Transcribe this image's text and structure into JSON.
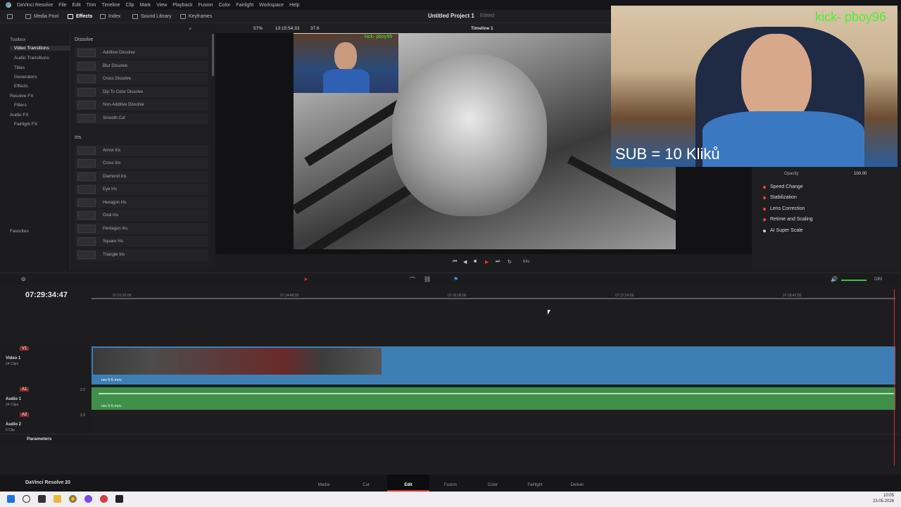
{
  "menu": {
    "app": "DaVinci Resolve",
    "items": [
      "File",
      "Edit",
      "Trim",
      "Timeline",
      "Clip",
      "Mark",
      "View",
      "Playback",
      "Fusion",
      "Color",
      "Fairlight",
      "Workspace",
      "Help"
    ]
  },
  "toolbar": {
    "media_pool": "Media Pool",
    "effects": "Effects",
    "index": "Index",
    "sound_library": "Sound Library",
    "keyframes": "Keyframes",
    "project_title": "Untitled Project 1",
    "project_status": "Edited",
    "zoom": "57%",
    "viewer_timecode": "13:15:54:33",
    "viewer_value": "37.6",
    "timeline_name": "Timeline 1"
  },
  "left_panel": {
    "items": [
      "Toolbox",
      "Video Transitions",
      "Audio Transitions",
      "Titles",
      "Generators",
      "Effects",
      "Resolve FX",
      "Filters",
      "Audio FX",
      "Fairlight FX"
    ],
    "favorites": "Favorites"
  },
  "effects": {
    "dissolve_header": "Dissolve",
    "dissolve": [
      "Additive Dissolve",
      "Blur Dissolve",
      "Cross Dissolve",
      "Dip To Color Dissolve",
      "Non-Additive Dissolve",
      "Smooth Cut"
    ],
    "iris_header": "Iris",
    "iris": [
      "Arrow Iris",
      "Cross Iris",
      "Diamond Iris",
      "Eye Iris",
      "Hexagon Iris",
      "Oval Iris",
      "Pentagon Iris",
      "Square Iris",
      "Triangle Iris"
    ]
  },
  "viewer": {
    "kick_small": "kick- pboy96",
    "speed": "64x"
  },
  "webcam": {
    "kick": "kick- pboy96",
    "sub": "SUB = 10 Kliků"
  },
  "inspector": {
    "opacity_label": "Opacity",
    "opacity_value": "100.00",
    "items": [
      "Speed Change",
      "Stabilization",
      "Lens Correction",
      "Retime and Scaling",
      "AI Super Scale"
    ]
  },
  "timeline": {
    "timecode": "07:29:34:47",
    "ticks": [
      "07:23:20:00",
      "07:24:48:00",
      "07:26:06:00",
      "07:27:24:00",
      "07:28:42:00"
    ],
    "v1": "V1",
    "video_track": "Video 1",
    "video_clips": "24 Clips",
    "a1": "A1",
    "audio_track": "Audio 1",
    "audio_clips": "24 Clips",
    "a1_level": "2.0",
    "a2": "A2",
    "audio2_track": "Audio 2",
    "audio2_clips": "0 Clip",
    "a2_level": "2.0",
    "clip_name": "res 9 6.mov",
    "audio_clip_name": "res 9 6.mov",
    "parameters": "Parameters",
    "dim": "DIM"
  },
  "pages": {
    "app_name": "DaVinci Resolve 20",
    "items": [
      "Media",
      "Cut",
      "Edit",
      "Fusion",
      "Color",
      "Fairlight",
      "Deliver"
    ]
  },
  "taskbar": {
    "time": "10:05",
    "date": "23.05.2026"
  }
}
